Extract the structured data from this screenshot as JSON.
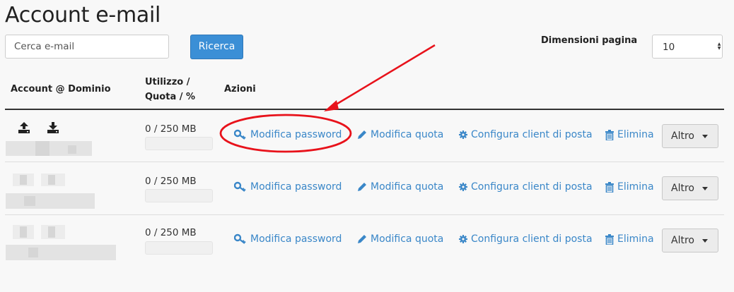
{
  "page": {
    "title": "Account e-mail"
  },
  "search": {
    "placeholder": "Cerca e-mail",
    "button_label": "Ricerca"
  },
  "page_size": {
    "label": "Dimensioni pagina",
    "value": "10"
  },
  "table": {
    "headers": {
      "account": "Account @ Dominio",
      "usage_line1": "Utilizzo /",
      "usage_line2": "Quota / %",
      "actions": "Azioni"
    },
    "rows": [
      {
        "quota": "0 / 250 MB",
        "usage_fraction": 0
      },
      {
        "quota": "0 / 250 MB",
        "usage_fraction": 0
      },
      {
        "quota": "0 / 250 MB",
        "usage_fraction": 0
      }
    ],
    "actions": {
      "modify_password": "Modifica password",
      "modify_quota": "Modifica quota",
      "configure_client": "Configura client di posta",
      "delete": "Elimina",
      "more": "Altro"
    }
  },
  "colors": {
    "link": "#3a87c8",
    "primary_button": "#3b8fd6",
    "annotation": "#e8121b"
  },
  "icons": [
    "upload-icon",
    "download-icon",
    "key-icon",
    "pencil-icon",
    "gear-icon",
    "trash-icon",
    "caret-down-icon"
  ]
}
